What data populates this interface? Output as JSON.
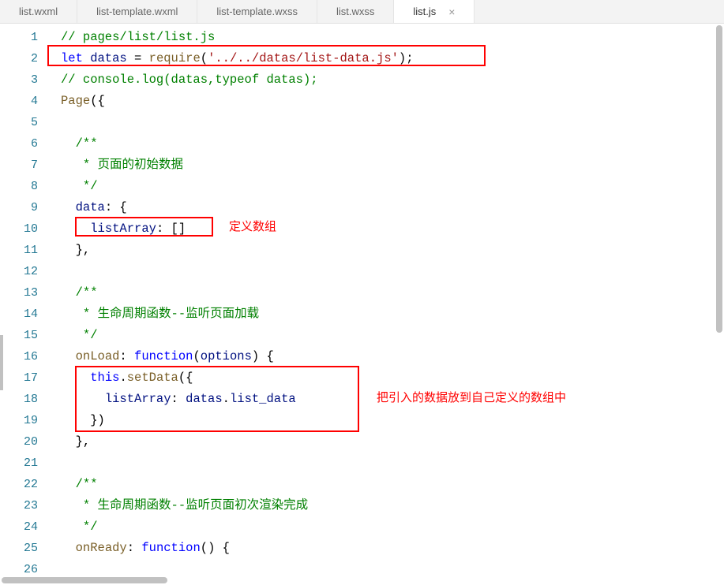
{
  "tabs": [
    {
      "label": "list.wxml",
      "active": false
    },
    {
      "label": "list-template.wxml",
      "active": false
    },
    {
      "label": "list-template.wxss",
      "active": false
    },
    {
      "label": "list.wxss",
      "active": false
    },
    {
      "label": "list.js",
      "active": true
    }
  ],
  "close_icon": "×",
  "lines": [
    "1",
    "2",
    "3",
    "4",
    "5",
    "6",
    "7",
    "8",
    "9",
    "10",
    "11",
    "12",
    "13",
    "14",
    "15",
    "16",
    "17",
    "18",
    "19",
    "20",
    "21",
    "22",
    "23",
    "24",
    "25",
    "26"
  ],
  "code": {
    "l1": "// pages/list/list.js",
    "l2_let": "let",
    "l2_var": " datas ",
    "l2_eq": "= ",
    "l2_req": "require",
    "l2_paren1": "(",
    "l2_str": "'../../datas/list-data.js'",
    "l2_paren2": ");",
    "l3": "// console.log(datas,typeof datas);",
    "l4_page": "Page",
    "l4_rest": "({",
    "l6": "/**",
    "l7": " * 页面的初始数据",
    "l8": " */",
    "l9_key": "data",
    "l9_rest": ": {",
    "l10_key": "listArray",
    "l10_rest": ": []",
    "l11": "},",
    "l13": "/**",
    "l14": " * 生命周期函数--监听页面加载",
    "l15": " */",
    "l16_key": "onLoad",
    "l16_colon": ": ",
    "l16_func": "function",
    "l16_rest": "(",
    "l16_param": "options",
    "l16_end": ") {",
    "l17_this": "this",
    "l17_dot": ".",
    "l17_set": "setData",
    "l17_rest": "({",
    "l18_key": "listArray",
    "l18_colon": ": ",
    "l18_datas": "datas",
    "l18_dot": ".",
    "l18_prop": "list_data",
    "l19": "})",
    "l20": "},",
    "l22": "/**",
    "l23": " * 生命周期函数--监听页面初次渲染完成",
    "l24": " */",
    "l25_key": "onReady",
    "l25_colon": ": ",
    "l25_func": "function",
    "l25_rest": "() {"
  },
  "annotations": {
    "a1": "定义数组",
    "a2": "把引入的数据放到自己定义的数组中"
  }
}
